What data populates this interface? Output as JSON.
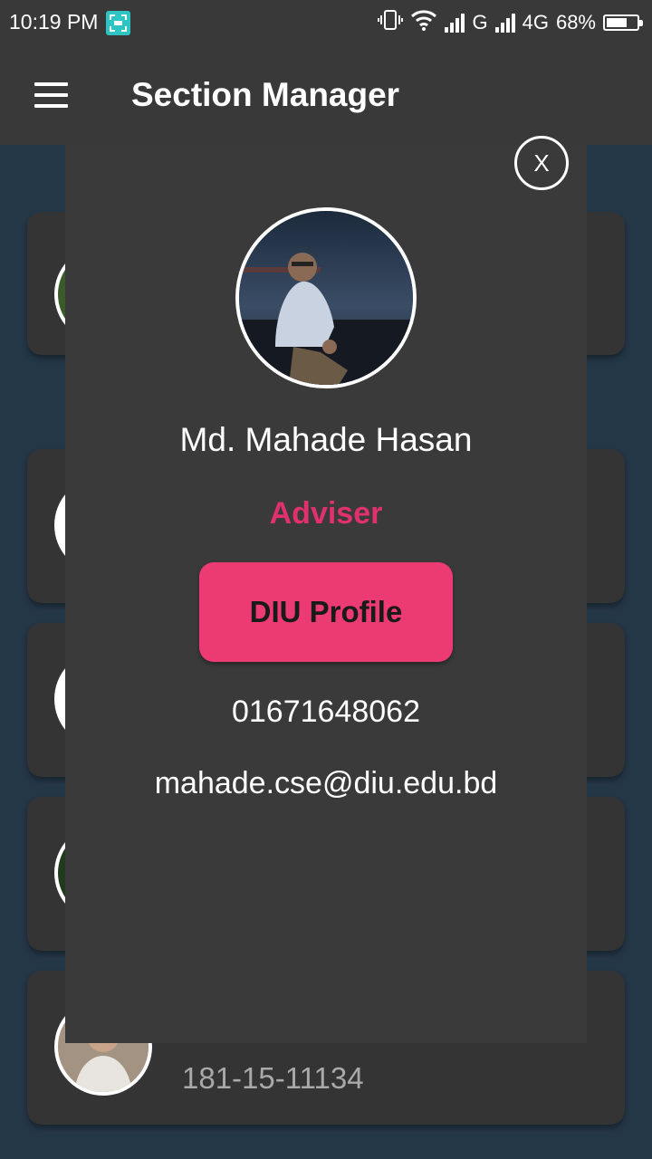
{
  "status_bar": {
    "time": "10:19 PM",
    "network_1": "G",
    "network_2": "4G",
    "battery_percent": "68%",
    "battery_level": 0.68
  },
  "app_bar": {
    "title": "Section Manager"
  },
  "dialog": {
    "close_label": "X",
    "name": "Md. Mahade Hasan",
    "role": "Adviser",
    "profile_button": "DIU Profile",
    "phone": "01671648062",
    "email": "mahade.cse@diu.edu.bd"
  },
  "list": {
    "items": [
      {
        "id": ""
      },
      {
        "id": ""
      },
      {
        "id": ""
      },
      {
        "id": ""
      },
      {
        "id": "181-15-11134"
      }
    ]
  },
  "colors": {
    "background": "#243747",
    "surface": "#3a3939",
    "accent": "#e0306d",
    "button": "#ec3b73"
  }
}
